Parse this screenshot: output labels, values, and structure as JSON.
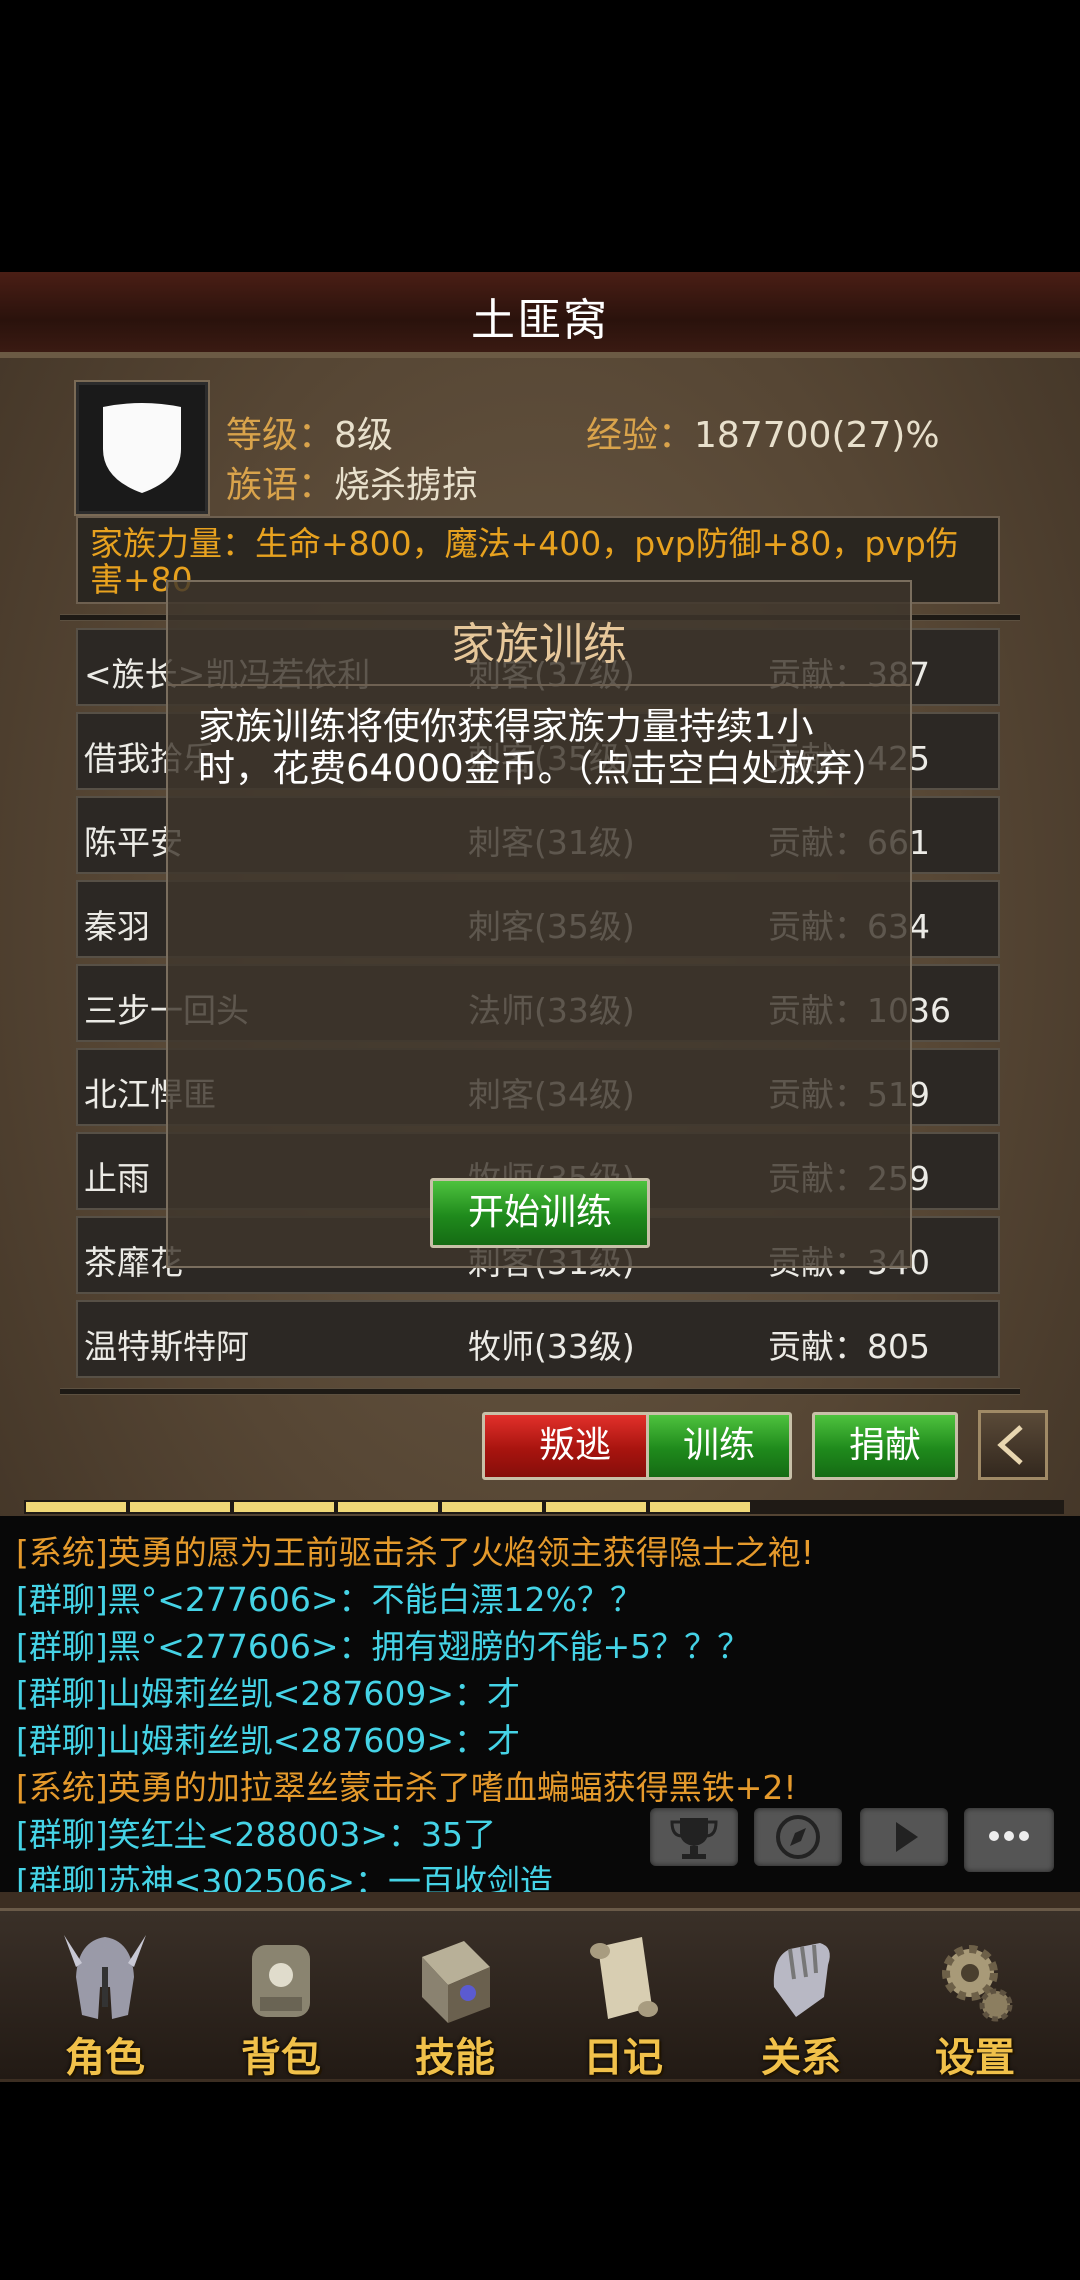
{
  "title": "土匪窝",
  "family": {
    "level_label": "等级：",
    "level_value": "8级",
    "exp_label": "经验：",
    "exp_value": "187700(27)%",
    "motto_label": "族语：",
    "motto_value": "烧杀掳掠",
    "power_text": "家族力量：生命+800，魔法+400，pvp防御+80，pvp伤害+80"
  },
  "members": [
    {
      "name": "<族长>凯冯若依利",
      "class": "刺客(37级)",
      "contrib": "贡献：387"
    },
    {
      "name": "借我拾乐",
      "class": "刺客(35级)",
      "contrib": "贡献：425"
    },
    {
      "name": "陈平安",
      "class": "刺客(31级)",
      "contrib": "贡献：661"
    },
    {
      "name": "秦羽",
      "class": "刺客(35级)",
      "contrib": "贡献：634"
    },
    {
      "name": "三步一回头",
      "class": "法师(33级)",
      "contrib": "贡献：1036"
    },
    {
      "name": "北江悍匪",
      "class": "刺客(34级)",
      "contrib": "贡献：519"
    },
    {
      "name": "止雨",
      "class": "牧师(35级)",
      "contrib": "贡献：259"
    },
    {
      "name": "茶靡花",
      "class": "刺客(31级)",
      "contrib": "贡献：340"
    },
    {
      "name": "温特斯特阿",
      "class": "牧师(33级)",
      "contrib": "贡献：805"
    }
  ],
  "dialog": {
    "title": "家族训练",
    "message": "家族训练将使你获得家族力量持续1小时，花费64000金币。（点击空白处放弃）",
    "start_button": "开始训练"
  },
  "actions": {
    "defect": "叛逃",
    "train": "训练",
    "donate": "捐献"
  },
  "chat": [
    {
      "text": "[系统]英勇的愿为王前驱击杀了火焰领主获得隐士之袍!",
      "color": "#e59a2c"
    },
    {
      "text": "[群聊]黑°<277606>：不能白漂12%？？",
      "color": "#45d3e6"
    },
    {
      "text": "[群聊]黑°<277606>：拥有翅膀的不能+5？？？",
      "color": "#45d3e6"
    },
    {
      "text": "[群聊]山姆莉丝凯<287609>：才",
      "color": "#45d3e6"
    },
    {
      "text": "[群聊]山姆莉丝凯<287609>：才",
      "color": "#45d3e6"
    },
    {
      "text": "[系统]英勇的加拉翠丝蒙击杀了嗜血蝙蝠获得黑铁+2!",
      "color": "#e59a2c"
    },
    {
      "text": "[群聊]笑红尘<288003>：35了",
      "color": "#45d3e6"
    },
    {
      "text": "[群聊]苏神<302506>：一百收剑造",
      "color": "#45d3e6"
    }
  ],
  "progress_filled_segments": 7,
  "progress_total_segments": 10,
  "nav": [
    {
      "label": "角色",
      "icon": "helmet-icon"
    },
    {
      "label": "背包",
      "icon": "backpack-icon"
    },
    {
      "label": "技能",
      "icon": "skill-book-icon"
    },
    {
      "label": "日记",
      "icon": "scroll-icon"
    },
    {
      "label": "关系",
      "icon": "gauntlet-icon"
    },
    {
      "label": "设置",
      "icon": "gear-icon"
    }
  ]
}
